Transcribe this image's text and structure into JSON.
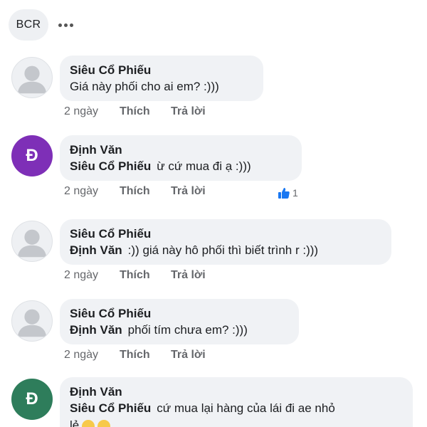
{
  "header": {
    "chip_label": "BCR"
  },
  "colors": {
    "avatar_purple": "#7e2fb7",
    "avatar_green": "#2e7d5b",
    "like_blue": "#1877f2"
  },
  "comments": [
    {
      "author": "Siêu Cổ Phiếu",
      "mention": "",
      "text": "Giá này phối cho ai em? :)))",
      "time": "2 ngày",
      "like": "Thích",
      "reply": "Trả lời",
      "avatar": "default-avatar"
    },
    {
      "author": "Định Văn",
      "mention": "Siêu Cổ Phiếu",
      "text": "ừ cứ mua đi ạ :)))",
      "time": "2 ngày",
      "like": "Thích",
      "reply": "Trả lời",
      "avatar_letter": "Đ",
      "reaction_count": "1"
    },
    {
      "author": "Siêu Cổ Phiếu",
      "mention": "Định Văn",
      "text": ":)) giá này hô phối thì biết trình r :)))",
      "time": "2 ngày",
      "like": "Thích",
      "reply": "Trả lời",
      "avatar": "default-avatar"
    },
    {
      "author": "Siêu Cổ Phiếu",
      "mention": "Định Văn",
      "text": "phối tím chưa em? :)))",
      "time": "2 ngày",
      "like": "Thích",
      "reply": "Trả lời",
      "avatar": "default-avatar"
    },
    {
      "author": "Định Văn",
      "mention": "Siêu Cổ Phiếu",
      "text": "cứ mua lại hàng của lái đi ae nhỏ",
      "text2": "lẻ",
      "avatar_letter": "Đ"
    }
  ]
}
